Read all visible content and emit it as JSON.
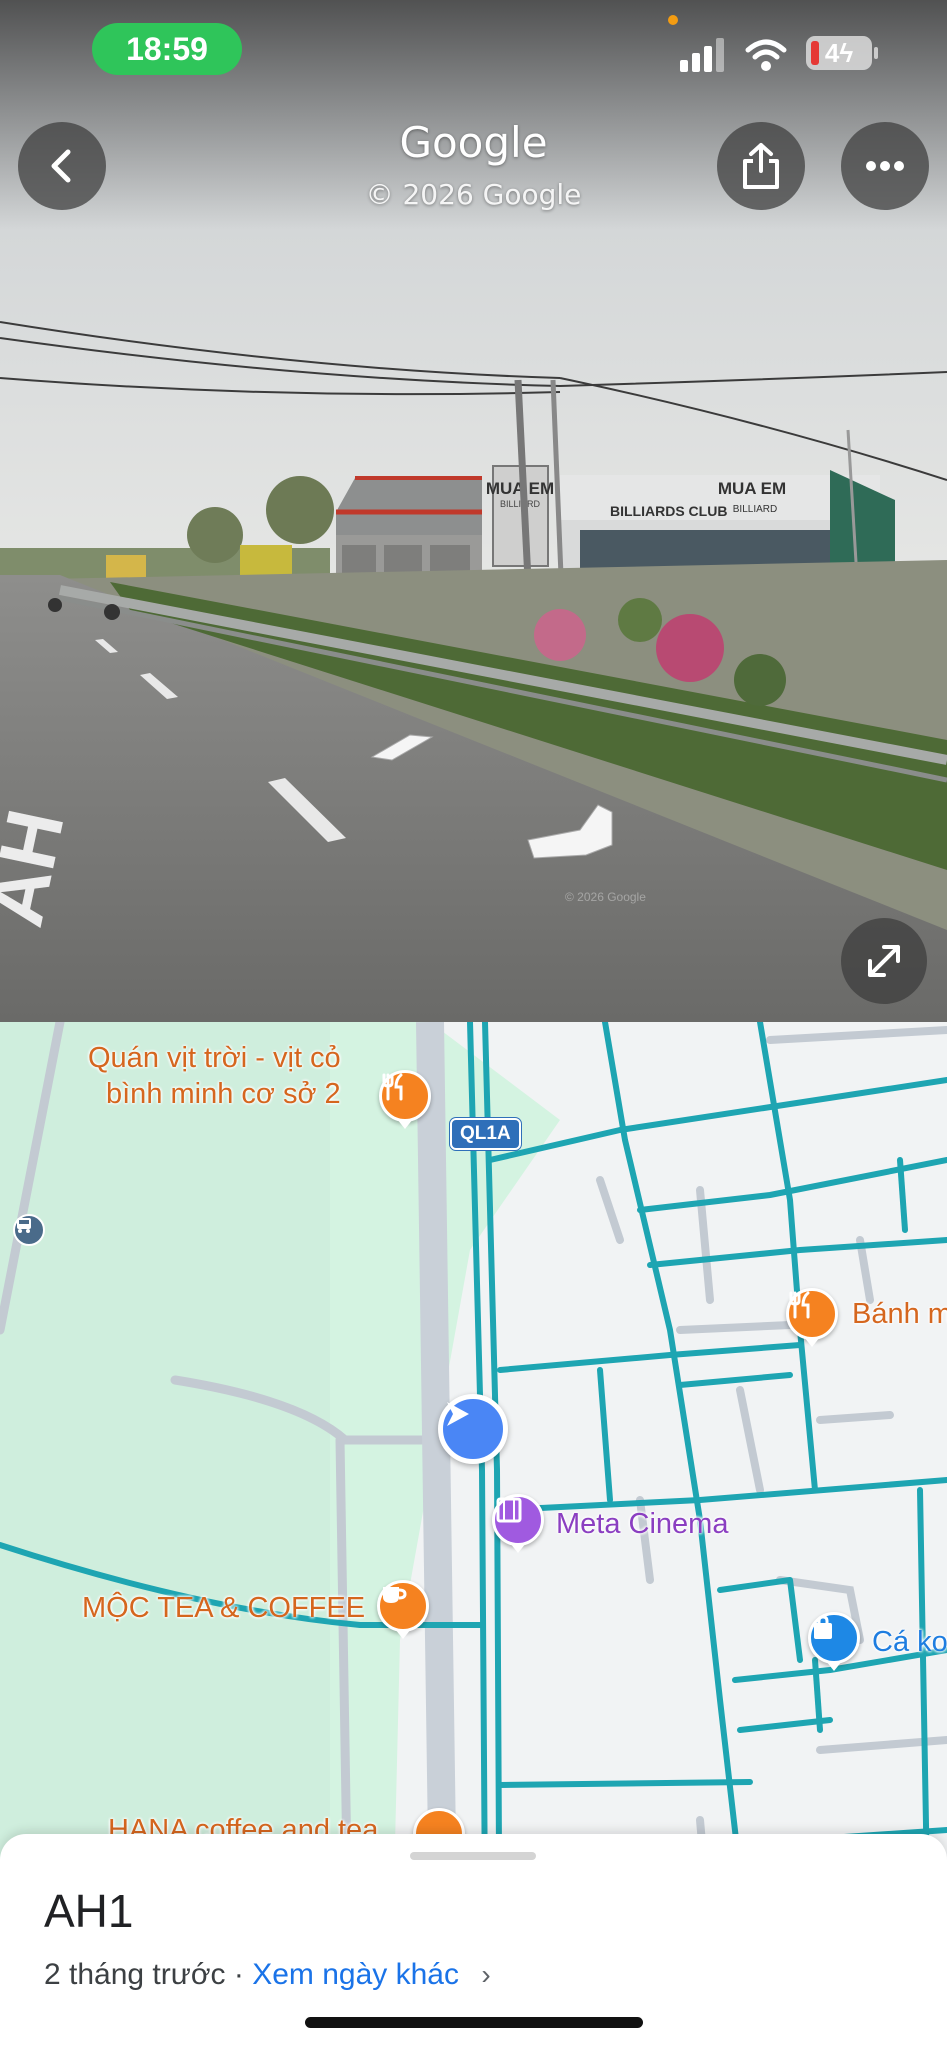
{
  "status_bar": {
    "time": "18:59",
    "battery": "4"
  },
  "streetview": {
    "title": "Google",
    "copyright": "© 2026 Google",
    "watermark": "© 2026 Google",
    "road_marking": "AH",
    "signs": {
      "building_left": "MUA EM",
      "building_left_sub": "BILLIARD",
      "club": "BILLIARDS CLUB",
      "building_right": "MUA EM",
      "building_right_sub": "BILLIARD"
    }
  },
  "map": {
    "road_shield": "QL1A",
    "pois": {
      "quan_vit": "Quán vịt trời - vịt cỏ\nbình minh cơ sở 2",
      "banh": "Bánh m",
      "meta_cinema": "Meta Cinema",
      "moc_tea": "MỘC TEA & COFFEE",
      "ca": "Cá ko",
      "hana": "HANA coffee and tea"
    }
  },
  "sheet": {
    "title": "AH1",
    "date": "2 tháng trước",
    "separator": "·",
    "link": "Xem ngày khác"
  },
  "colors": {
    "accent": "#1a73e8",
    "road_teal": "#1ea5b2",
    "green_area": "#d6f5e3",
    "time_pill": "#2fc55a"
  }
}
